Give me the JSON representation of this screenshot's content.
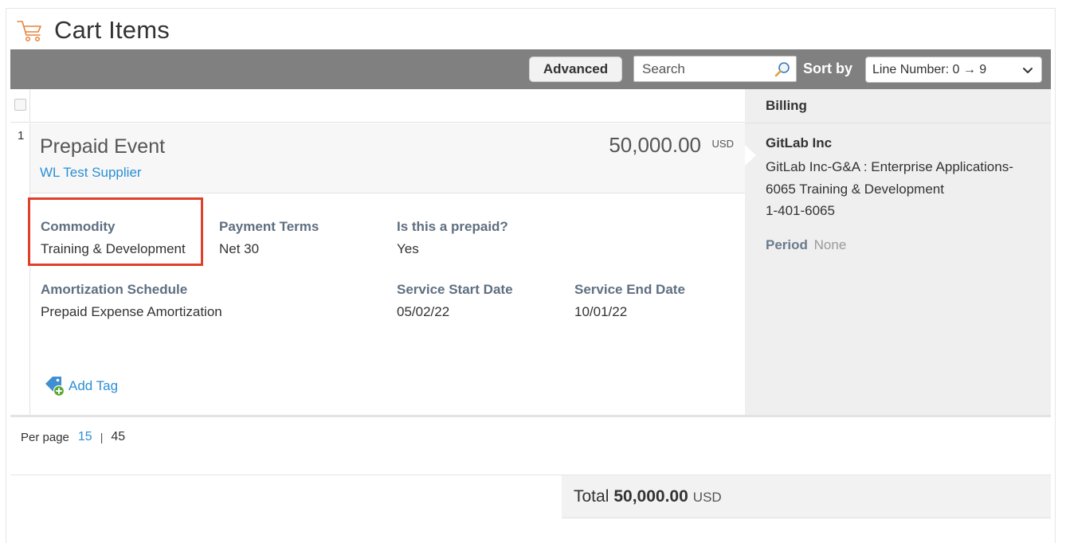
{
  "page": {
    "title": "Cart Items"
  },
  "toolbar": {
    "advanced_label": "Advanced",
    "search_placeholder": "Search",
    "sort_label": "Sort by",
    "sort_value": "Line Number: 0 → 9"
  },
  "item": {
    "line_number": "1",
    "name": "Prepaid Event",
    "supplier": "WL Test Supplier",
    "price": "50,000.00",
    "currency": "USD",
    "fields": {
      "commodity": {
        "label": "Commodity",
        "value": "Training & Development"
      },
      "payment_terms": {
        "label": "Payment Terms",
        "value": "Net 30"
      },
      "prepaid": {
        "label": "Is this a prepaid?",
        "value": "Yes"
      },
      "amortization": {
        "label": "Amortization Schedule",
        "value": "Prepaid Expense Amortization"
      },
      "service_start": {
        "label": "Service Start Date",
        "value": "05/02/22"
      },
      "service_end": {
        "label": "Service End Date",
        "value": "10/01/22"
      }
    },
    "add_tag_label": "Add Tag"
  },
  "billing": {
    "header": "Billing",
    "company": "GitLab Inc",
    "lines": [
      "GitLab Inc-G&A : Enterprise Applications-",
      "6065 Training & Development",
      "1-401-6065"
    ],
    "period_label": "Period",
    "period_value": "None"
  },
  "pagination": {
    "label": "Per page",
    "options": [
      "15",
      "45"
    ],
    "active": "15"
  },
  "totals": {
    "label": "Total",
    "amount": "50,000.00",
    "currency": "USD"
  },
  "colors": {
    "accent_link": "#2b8fd6",
    "toolbar_bg": "#808080",
    "highlight_border": "#e0402b",
    "cart_icon": "#e8833a"
  }
}
